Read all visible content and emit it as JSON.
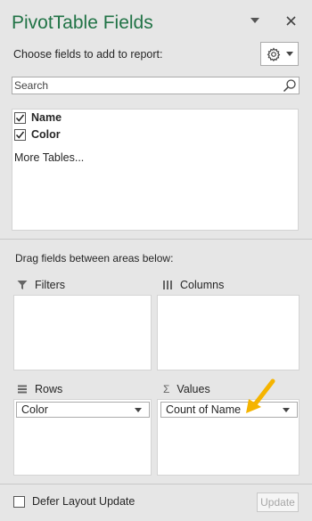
{
  "pane": {
    "title": "PivotTable Fields",
    "choose_label": "Choose fields to add to report:"
  },
  "search": {
    "placeholder": "Search"
  },
  "fields": [
    {
      "label": "Name",
      "checked": true
    },
    {
      "label": "Color",
      "checked": true
    }
  ],
  "more_tables": "More Tables...",
  "drag_label": "Drag fields between areas below:",
  "areas": {
    "filters": {
      "label": "Filters",
      "items": []
    },
    "columns": {
      "label": "Columns",
      "items": []
    },
    "rows": {
      "label": "Rows",
      "items": [
        "Color"
      ]
    },
    "values": {
      "label": "Values",
      "items": [
        "Count of Name"
      ]
    }
  },
  "footer": {
    "defer_label": "Defer Layout Update",
    "update_label": "Update"
  },
  "colors": {
    "title_green": "#217346",
    "arrow": "#f5b400"
  }
}
